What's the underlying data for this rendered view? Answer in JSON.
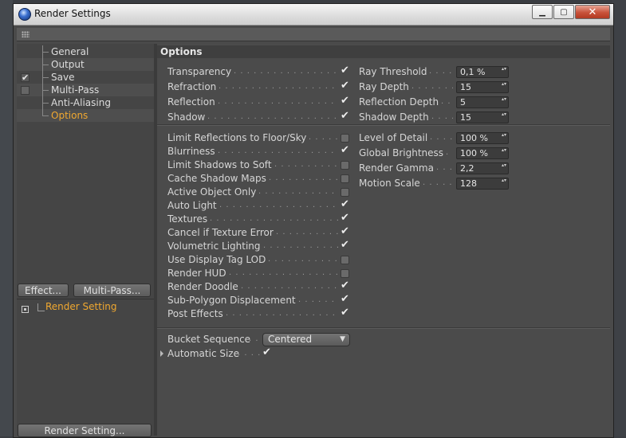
{
  "window": {
    "title": "Render Settings"
  },
  "tree": [
    {
      "label": "General",
      "checked": null
    },
    {
      "label": "Output",
      "checked": null
    },
    {
      "label": "Save",
      "checked": true
    },
    {
      "label": "Multi-Pass",
      "checked": false
    },
    {
      "label": "Anti-Aliasing",
      "checked": null
    },
    {
      "label": "Options",
      "checked": null,
      "active": true
    }
  ],
  "buttons": {
    "effect": "Effect...",
    "multipass": "Multi-Pass...",
    "render_setting": "Render Setting..."
  },
  "render_list": {
    "item": "Render Setting"
  },
  "options": {
    "header": "Options",
    "group1_left": [
      {
        "label": "Transparency",
        "checked": true
      },
      {
        "label": "Refraction",
        "checked": true
      },
      {
        "label": "Reflection",
        "checked": true
      },
      {
        "label": "Shadow",
        "checked": true
      }
    ],
    "group1_right": [
      {
        "label": "Ray Threshold",
        "value": "0,1 %"
      },
      {
        "label": "Ray Depth",
        "value": "15"
      },
      {
        "label": "Reflection Depth",
        "value": "5"
      },
      {
        "label": "Shadow Depth",
        "value": "15"
      }
    ],
    "group2_left": [
      {
        "label": "Limit Reflections to Floor/Sky",
        "checked": false
      },
      {
        "label": "Blurriness",
        "checked": true
      },
      {
        "label": "Limit Shadows to Soft",
        "checked": false
      },
      {
        "label": "Cache Shadow Maps",
        "checked": false
      },
      {
        "label": "Active Object Only",
        "checked": false
      },
      {
        "label": "Auto Light",
        "checked": true
      },
      {
        "label": "Textures",
        "checked": true
      },
      {
        "label": "Cancel if Texture Error",
        "checked": true
      },
      {
        "label": "Volumetric Lighting",
        "checked": true
      },
      {
        "label": "Use Display Tag LOD",
        "checked": false
      },
      {
        "label": "Render HUD",
        "checked": false
      },
      {
        "label": "Render Doodle",
        "checked": true
      },
      {
        "label": "Sub-Polygon Displacement",
        "checked": true
      },
      {
        "label": "Post Effects",
        "checked": true
      }
    ],
    "group2_right": [
      {
        "label": "Level of Detail",
        "value": "100 %"
      },
      {
        "label": "Global Brightness",
        "value": "100 %"
      },
      {
        "label": "Render Gamma",
        "value": "2,2"
      },
      {
        "label": "Motion Scale",
        "value": "128"
      }
    ],
    "bucket_label": "Bucket Sequence",
    "bucket_value": "Centered",
    "auto_size_label": "Automatic Size",
    "auto_size_checked": true
  }
}
